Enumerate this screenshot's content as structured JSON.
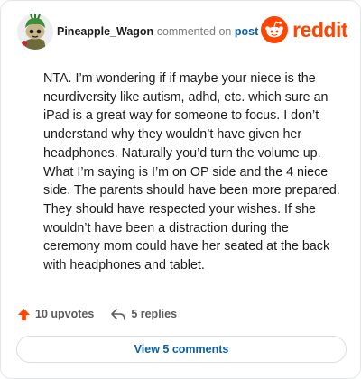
{
  "header": {
    "username": "Pineapple_Wagon",
    "commented_on": "commented on",
    "post_link": "post",
    "brand": "reddit",
    "avatar_icon": "snoo-avatar-icon",
    "logo_icon": "reddit-snoo-icon"
  },
  "comment": {
    "body": "NTA. I’m wondering if if maybe your niece is the neurdiversity like autism, adhd, etc. which sure an iPad is a great way for someone to focus. I don’t understand why they wouldn’t have given her headphones. Naturally you’d turn the volume up. What I’m saying is I’m on OP side and the 4 niece side. The parents should have been more prepared. They should have respected your wishes. If she wouldn’t have been a distraction during the ceremony mom could have her seated at the back with headphones and tablet."
  },
  "actions": {
    "upvotes": "10 upvotes",
    "replies": "5 replies",
    "upvote_icon": "upvote-arrow-icon",
    "reply_icon": "reply-arrow-icon"
  },
  "footer": {
    "view_comments": "View 5 comments"
  },
  "colors": {
    "brand_orange": "#ff4500",
    "link_blue": "#0a5fa8",
    "muted_text": "#7c7c7c"
  }
}
